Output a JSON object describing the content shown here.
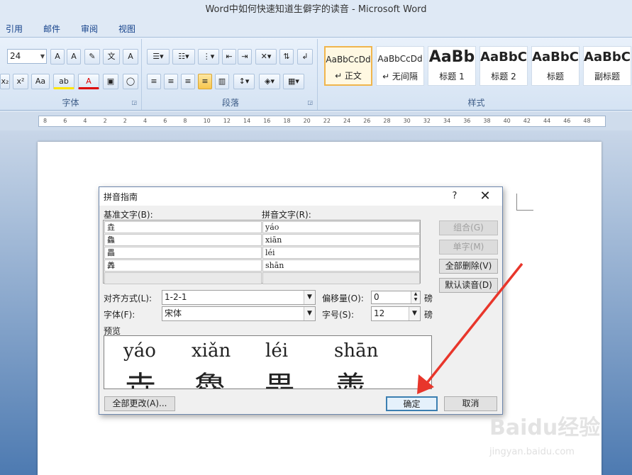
{
  "window": {
    "title": "Word中如何快速知道生僻字的读音 - Microsoft Word"
  },
  "tabs": [
    "引用",
    "邮件",
    "审阅",
    "视图"
  ],
  "ribbon": {
    "font_size": "24",
    "font_group": "字体",
    "paragraph_group": "段落",
    "styles_group": "样式",
    "styles": [
      {
        "sample": "AaBbCcDd",
        "name": "↵ 正文"
      },
      {
        "sample": "AaBbCcDd",
        "name": "↵ 无间隔"
      },
      {
        "sample": "AaBb",
        "name": "标题 1"
      },
      {
        "sample": "AaBbC",
        "name": "标题 2"
      },
      {
        "sample": "AaBbC",
        "name": "标题"
      },
      {
        "sample": "AaBbC",
        "name": "副标题"
      }
    ],
    "font_buttons": [
      "A",
      "A",
      "A",
      "x₂",
      "x²",
      "Aa",
      "ab",
      "A"
    ]
  },
  "ruler": {
    "ticks": [
      "8",
      "6",
      "4",
      "2",
      "2",
      "4",
      "6",
      "8",
      "10",
      "12",
      "14",
      "16",
      "18",
      "20",
      "22",
      "24",
      "26",
      "28",
      "30",
      "32",
      "34",
      "36",
      "38",
      "40",
      "42",
      "44",
      "46",
      "48"
    ]
  },
  "dialog": {
    "title": "拼音指南",
    "help": "?",
    "close": "✕",
    "base_text_label": "基准文字(B):",
    "ruby_text_label": "拼音文字(R):",
    "rows": [
      {
        "base": "垚",
        "ruby": "yáo"
      },
      {
        "base": "鱻",
        "ruby": "xiān"
      },
      {
        "base": "畾",
        "ruby": "léi"
      },
      {
        "base": "羴",
        "ruby": "shān"
      }
    ],
    "buttons": {
      "group": "组合(G)",
      "single": "单字(M)",
      "clear_all": "全部删除(V)",
      "default_reading": "默认读音(D)",
      "change_all": "全部更改(A)...",
      "ok": "确定",
      "cancel": "取消"
    },
    "alignment_label": "对齐方式(L):",
    "alignment_value": "1-2-1",
    "offset_label": "偏移量(O):",
    "offset_value": "0",
    "offset_unit": "磅",
    "font_label": "字体(F):",
    "font_value": "宋体",
    "size_label": "字号(S):",
    "size_value": "12",
    "size_unit": "磅",
    "preview_label": "预览",
    "preview": [
      {
        "pinyin": "yáo",
        "char": "垚"
      },
      {
        "pinyin": "xiǎn",
        "char": "鱻"
      },
      {
        "pinyin": "léi",
        "char": "畾"
      },
      {
        "pinyin": "shān",
        "char": "羴"
      }
    ]
  },
  "watermark": {
    "brand": "Baidu经验",
    "url": "jingyan.baidu.com"
  },
  "colors": {
    "arrow": "#e8362b",
    "ribbon": "#dfe9f5",
    "accent": "#15428b"
  }
}
